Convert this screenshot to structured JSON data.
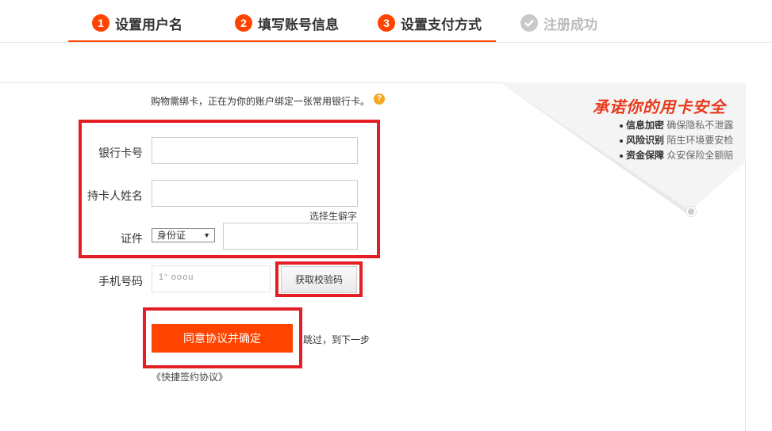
{
  "steps": [
    {
      "num": "1",
      "label": "设置用户名"
    },
    {
      "num": "2",
      "label": "填写账号信息"
    },
    {
      "num": "3",
      "label": "设置支付方式"
    },
    {
      "label": "注册成功"
    }
  ],
  "form": {
    "note": "购物需绑卡，正在为你的账户绑定一张常用银行卡。",
    "help_icon": "?",
    "card_number_label": "银行卡号",
    "holder_name_label": "持卡人姓名",
    "rare_char_link": "选择生僻字",
    "id_label": "证件",
    "id_type_selected": "身份证",
    "phone_label": "手机号码",
    "phone_value": "1“     ooou",
    "get_code_button": "获取校验码",
    "agree_button": "同意协议并确定",
    "skip_link": "跳过，到下一步",
    "protocol_link": "《快捷签约协议》"
  },
  "promise": {
    "title": "承诺你的用卡安全",
    "items": [
      {
        "bold": "信息加密",
        "text": "确保隐私不泄露"
      },
      {
        "bold": "风险识别",
        "text": "陌生环境要安检"
      },
      {
        "bold": "资金保障",
        "text": "众安保险全额赔"
      }
    ]
  },
  "colors": {
    "accent": "#ff4400",
    "highlight_box": "#e31e24",
    "done_step": "#bbbbbb"
  }
}
